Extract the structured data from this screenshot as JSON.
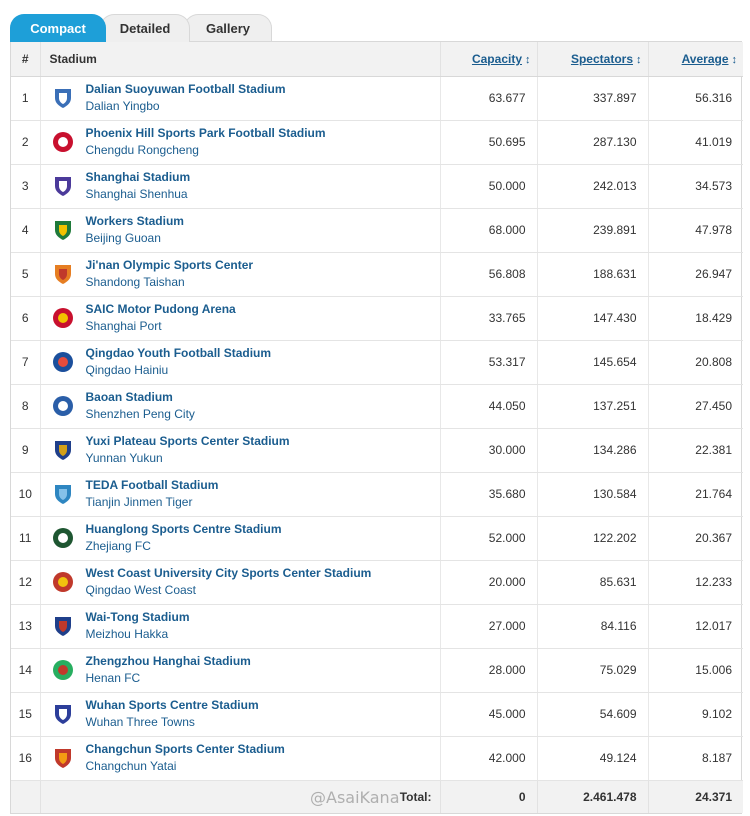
{
  "tabs": [
    {
      "label": "Compact"
    },
    {
      "label": "Detailed"
    },
    {
      "label": "Gallery"
    }
  ],
  "table": {
    "headers": {
      "num": "#",
      "stadium": "Stadium",
      "capacity": "Capacity",
      "spectators": "Spectators",
      "average": "Average"
    },
    "rows": [
      {
        "rank": "1",
        "stadium": "Dalian Suoyuwan Football Stadium",
        "club": "Dalian Yingbo",
        "capacity": "63.677",
        "spectators": "337.897",
        "average": "56.316"
      },
      {
        "rank": "2",
        "stadium": "Phoenix Hill Sports Park Football Stadium",
        "club": "Chengdu Rongcheng",
        "capacity": "50.695",
        "spectators": "287.130",
        "average": "41.019"
      },
      {
        "rank": "3",
        "stadium": "Shanghai Stadium",
        "club": "Shanghai Shenhua",
        "capacity": "50.000",
        "spectators": "242.013",
        "average": "34.573"
      },
      {
        "rank": "4",
        "stadium": "Workers Stadium",
        "club": "Beijing Guoan",
        "capacity": "68.000",
        "spectators": "239.891",
        "average": "47.978"
      },
      {
        "rank": "5",
        "stadium": "Ji'nan Olympic Sports Center",
        "club": "Shandong Taishan",
        "capacity": "56.808",
        "spectators": "188.631",
        "average": "26.947"
      },
      {
        "rank": "6",
        "stadium": "SAIC Motor Pudong Arena",
        "club": "Shanghai Port",
        "capacity": "33.765",
        "spectators": "147.430",
        "average": "18.429"
      },
      {
        "rank": "7",
        "stadium": "Qingdao Youth Football Stadium",
        "club": "Qingdao Hainiu",
        "capacity": "53.317",
        "spectators": "145.654",
        "average": "20.808"
      },
      {
        "rank": "8",
        "stadium": "Baoan Stadium",
        "club": "Shenzhen Peng City",
        "capacity": "44.050",
        "spectators": "137.251",
        "average": "27.450"
      },
      {
        "rank": "9",
        "stadium": "Yuxi Plateau Sports Center Stadium",
        "club": "Yunnan Yukun",
        "capacity": "30.000",
        "spectators": "134.286",
        "average": "22.381"
      },
      {
        "rank": "10",
        "stadium": "TEDA Football Stadium",
        "club": "Tianjin Jinmen Tiger",
        "capacity": "35.680",
        "spectators": "130.584",
        "average": "21.764"
      },
      {
        "rank": "11",
        "stadium": "Huanglong Sports Centre Stadium",
        "club": "Zhejiang FC",
        "capacity": "52.000",
        "spectators": "122.202",
        "average": "20.367"
      },
      {
        "rank": "12",
        "stadium": "West Coast University City Sports Center Stadium",
        "club": "Qingdao West Coast",
        "capacity": "20.000",
        "spectators": "85.631",
        "average": "12.233"
      },
      {
        "rank": "13",
        "stadium": "Wai-Tong Stadium",
        "club": "Meizhou Hakka",
        "capacity": "27.000",
        "spectators": "84.116",
        "average": "12.017"
      },
      {
        "rank": "14",
        "stadium": "Zhengzhou Hanghai Stadium",
        "club": "Henan FC",
        "capacity": "28.000",
        "spectators": "75.029",
        "average": "15.006"
      },
      {
        "rank": "15",
        "stadium": "Wuhan Sports Centre Stadium",
        "club": "Wuhan Three Towns",
        "capacity": "45.000",
        "spectators": "54.609",
        "average": "9.102"
      },
      {
        "rank": "16",
        "stadium": "Changchun Sports Center Stadium",
        "club": "Changchun Yatai",
        "capacity": "42.000",
        "spectators": "49.124",
        "average": "8.187"
      }
    ],
    "totals": {
      "label": "Total:",
      "capacity": "0",
      "spectators": "2.461.478",
      "average": "24.371"
    }
  },
  "logos": [
    {
      "color": "#3a6fb7",
      "accent": "#ffffff"
    },
    {
      "color": "#c8102e",
      "accent": "#ffffff"
    },
    {
      "color": "#4b3a9a",
      "accent": "#ffffff"
    },
    {
      "color": "#1f7a3a",
      "accent": "#f2c200"
    },
    {
      "color": "#e67e22",
      "accent": "#c0392b"
    },
    {
      "color": "#c8102e",
      "accent": "#f2c200"
    },
    {
      "color": "#1b4f9c",
      "accent": "#e74c3c"
    },
    {
      "color": "#2a5ea8",
      "accent": "#ffffff"
    },
    {
      "color": "#1f3f8a",
      "accent": "#d4a017"
    },
    {
      "color": "#2e86c1",
      "accent": "#85c1e9"
    },
    {
      "color": "#1e5631",
      "accent": "#ffffff"
    },
    {
      "color": "#c0392b",
      "accent": "#f1c40f"
    },
    {
      "color": "#1f3f8a",
      "accent": "#c0392b"
    },
    {
      "color": "#27ae60",
      "accent": "#c0392b"
    },
    {
      "color": "#2c3e9a",
      "accent": "#ffffff"
    },
    {
      "color": "#c0392b",
      "accent": "#f39c12"
    }
  ],
  "watermark": "@AsaiKana",
  "colors": {
    "accent": "#1e9fd8",
    "link": "#1b5d8f",
    "header_bg": "#f2f2f2"
  }
}
